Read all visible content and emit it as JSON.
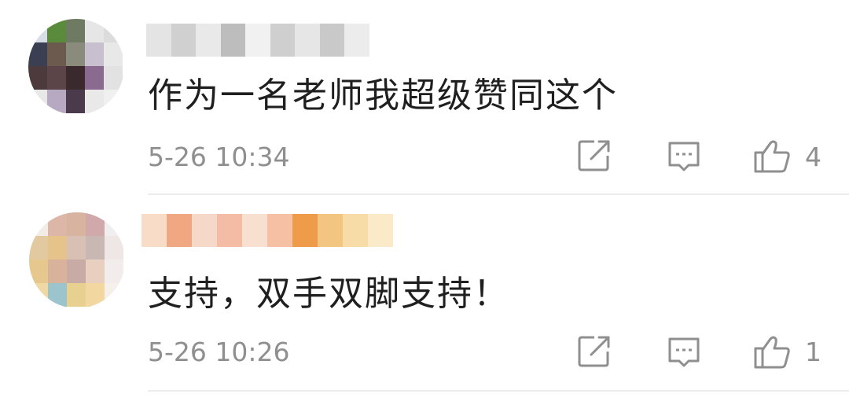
{
  "comments": [
    {
      "text": "作为一名老师我超级赞同这个",
      "time": "5-26 10:34",
      "likes": "4",
      "avatar_colors": [
        "#d8dde6",
        "#5a8a3c",
        "#6e7a62",
        "#e6e6e6",
        "#dcdcdc",
        "#3b3f52",
        "#6c5a4e",
        "#8a8b7d",
        "#c9c0cf",
        "#e8e8e8",
        "#4c3a3c",
        "#5c4548",
        "#3a2a2e",
        "#8a6a8e",
        "#e2e2e2",
        "#e8e8e8",
        "#b7a9c2",
        "#4a3a4c",
        "#e9e9e9",
        "#f0f0f0"
      ],
      "username_colors": [
        "#e4e4e4",
        "#d0d0d0",
        "#e9e9e9",
        "#bdbdbd",
        "#f1f1f1",
        "#cfcfcf",
        "#e6e6e6",
        "#c9c9c9",
        "#ececec"
      ]
    },
    {
      "text": "支持，双手双脚支持！",
      "time": "5-26 10:26",
      "likes": "1",
      "avatar_colors": [
        "#f2ece6",
        "#dcb7a8",
        "#d8b3a0",
        "#d2a9aa",
        "#f0eeee",
        "#e2c9a0",
        "#e6c38a",
        "#d8c0b4",
        "#c9b7b4",
        "#efe6e6",
        "#e6c88e",
        "#d8b29a",
        "#c7aba4",
        "#e9cfc0",
        "#f2ecec",
        "#f0d8a4",
        "#9cc4cc",
        "#e8d090",
        "#f2d8a0",
        "#f6f0ea"
      ],
      "username_colors": [
        "#f8dcc8",
        "#f0a882",
        "#f6d8c8",
        "#f4bca4",
        "#f8e0d0",
        "#f6c0a4",
        "#ee9c4a",
        "#f2c680",
        "#f8dca8",
        "#faeac8"
      ]
    }
  ],
  "icons": {
    "share": "share-icon",
    "reply": "comment-icon",
    "like": "thumbs-up-icon"
  },
  "colors": {
    "meta": "#8f8f8f",
    "icon": "#8f8f8f",
    "divider": "#ececec"
  }
}
